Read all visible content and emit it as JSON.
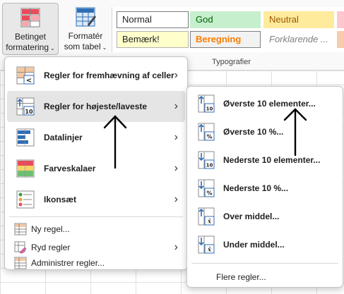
{
  "ribbon": {
    "conditional_formatting": {
      "line1": "Betinget",
      "line2": "formatering",
      "caret": "⌄"
    },
    "format_as_table": {
      "line1": "Formatér",
      "line2": "som tabel",
      "caret": "⌄"
    },
    "styles": {
      "group_label": "Typografier",
      "items": [
        "Normal",
        "God",
        "Neutral",
        "Bemærk!",
        "Beregning",
        "Forklarende ..."
      ]
    }
  },
  "main_menu": {
    "items": [
      {
        "label": "Regler for fremhævning af celler",
        "icon": "highlight-cells-rules-icon",
        "has_submenu": true
      },
      {
        "label": "Regler for højeste/laveste",
        "icon": "top-bottom-rules-icon",
        "has_submenu": true,
        "highlighted": true
      },
      {
        "label": "Datalinjer",
        "icon": "data-bars-icon",
        "has_submenu": true
      },
      {
        "label": "Farveskalaer",
        "icon": "color-scales-icon",
        "has_submenu": true
      },
      {
        "label": "Ikonsæt",
        "icon": "icon-sets-icon",
        "has_submenu": true
      },
      {
        "label": "Ny regel...",
        "icon": "new-rule-icon"
      },
      {
        "label": "Ryd regler",
        "icon": "clear-rules-icon",
        "has_submenu": true
      },
      {
        "label": "Administrer regler...",
        "icon": "manage-rules-icon"
      }
    ],
    "arrow_glyph": "›"
  },
  "submenu": {
    "items": [
      {
        "label": "Øverste 10 elementer...",
        "icon": "top-10-items-icon",
        "badge": "10"
      },
      {
        "label": "Øverste 10 %...",
        "icon": "top-10-percent-icon",
        "badge": "%"
      },
      {
        "label": "Nederste 10 elementer...",
        "icon": "bottom-10-items-icon",
        "badge": "10"
      },
      {
        "label": "Nederste 10 %...",
        "icon": "bottom-10-percent-icon",
        "badge": "%"
      },
      {
        "label": "Over middel...",
        "icon": "above-average-icon",
        "badge": "x̄"
      },
      {
        "label": "Under middel...",
        "icon": "below-average-icon",
        "badge": "x̄"
      },
      {
        "label": "Flere regler...",
        "icon": ""
      }
    ]
  },
  "colors": {
    "menu_highlight": "#e5e5e5",
    "icon_blue": "#2f6eb7",
    "icon_red": "#e84c5b",
    "icon_orange": "#e8a33b",
    "icon_green": "#3a9a4a"
  }
}
